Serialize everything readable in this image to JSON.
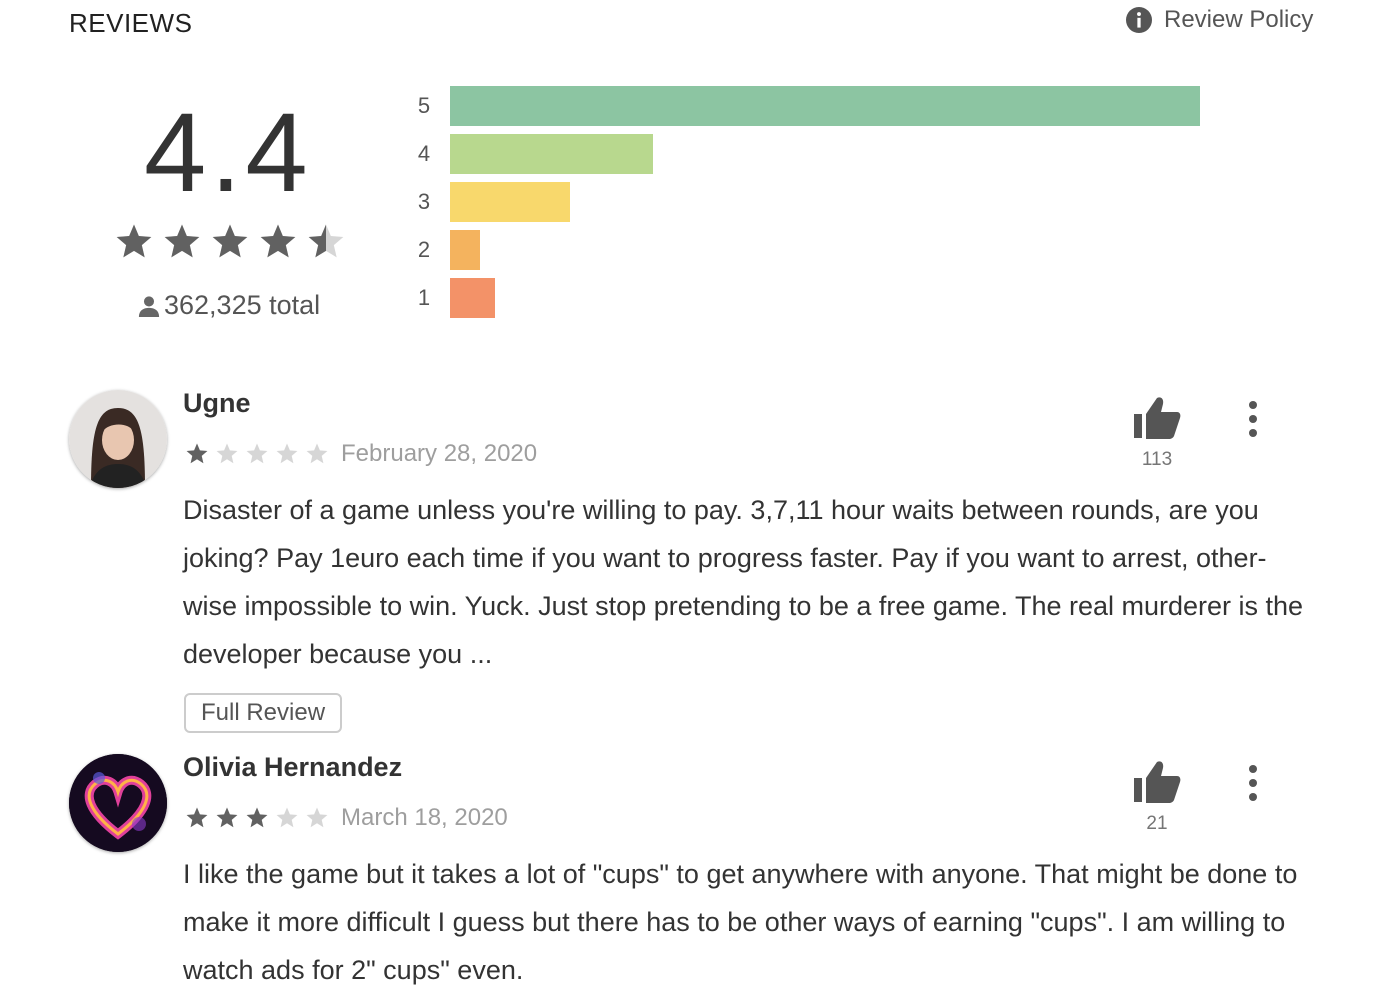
{
  "header": {
    "title": "REVIEWS",
    "policy_label": "Review Policy"
  },
  "summary": {
    "score": "4.4",
    "stars": 4.5,
    "total": "362,325 total"
  },
  "histogram": [
    {
      "label": "5",
      "fraction": 1.0,
      "color": "#8CC5A2"
    },
    {
      "label": "4",
      "fraction": 0.27,
      "color": "#B8D88E"
    },
    {
      "label": "3",
      "fraction": 0.16,
      "color": "#F8D86C"
    },
    {
      "label": "2",
      "fraction": 0.04,
      "color": "#F4B35E"
    },
    {
      "label": "1",
      "fraction": 0.06,
      "color": "#F39268"
    }
  ],
  "reviews": [
    {
      "name": "Ugne",
      "rating": 1,
      "date": "February 28, 2020",
      "likes": "113",
      "text": "Disaster of a game unless you're willing to pay. 3,7,11 hour waits between rounds, are you joking? Pay 1euro each time if you want to progress faster. Pay if you want to arrest, other-wise impossible to win. Yuck. Just stop pretending to be a free game. The real murderer is the developer because you ...",
      "full_review_label": "Full Review"
    },
    {
      "name": "Olivia Hernandez",
      "rating": 3,
      "date": "March 18, 2020",
      "likes": "21",
      "text": "I like the game but it takes a lot of \"cups\" to get anywhere with anyone. That might be done to make it more difficult I guess but there has to be other ways of earning \"cups\". I am willing to watch ads for 2\" cups\" even."
    }
  ],
  "colors": {
    "star_filled": "#616161",
    "star_empty": "#d6d6d6",
    "icon": "#555555"
  }
}
